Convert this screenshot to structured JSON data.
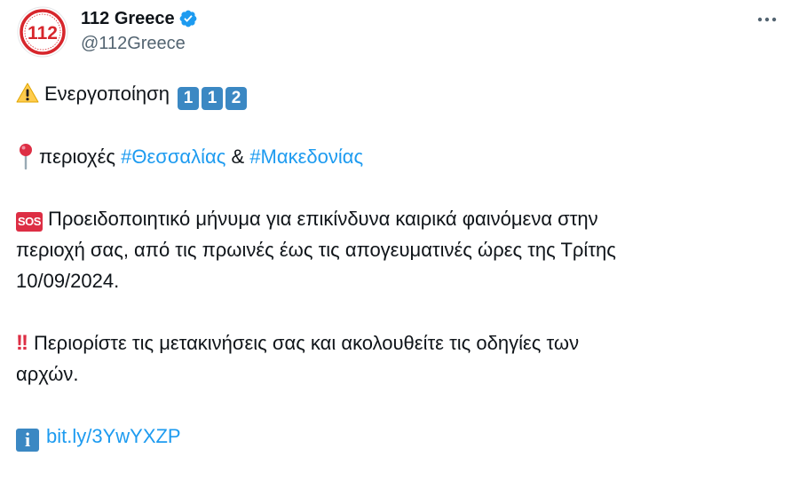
{
  "author": {
    "display_name": "112 Greece",
    "handle": "@112Greece",
    "avatar_text": "112",
    "verified": true
  },
  "icons": {
    "verified": "verified-badge-icon",
    "more": "more-options-icon",
    "warning": "warning-icon",
    "pin": "round-pushpin-icon",
    "sos": "sos-button-icon",
    "exclamation": "double-exclamation-icon",
    "info": "information-icon"
  },
  "colors": {
    "link": "#1d9bf0",
    "verified": "#1d9bf0",
    "keycap": "#3b88c3",
    "alert_red": "#dd2e44",
    "brand_red": "#d7262c",
    "secondary_text": "#536471"
  },
  "tweet": {
    "line1": {
      "text": "Ενεργοποίηση",
      "keycaps": [
        "1",
        "1",
        "2"
      ]
    },
    "line2": {
      "prefix": "περιοχές",
      "hashtag1": "#Θεσσαλίας",
      "amp": "&",
      "hashtag2": "#Μακεδονίας"
    },
    "line3": {
      "sos_label": "SOS",
      "text_a": "Προειδοποιητικό μήνυμα για επικίνδυνα καιρικά φαινόμενα στην",
      "text_b": "περιοχή σας, από τις πρωινές έως τις απογευματινές ώρες της Τρίτης",
      "text_c": "10/09/2024."
    },
    "line4": {
      "bangs": "!!",
      "text_a": "Περιορίστε τις μετακινήσεις σας και ακολουθείτε τις οδηγίες των",
      "text_b": "αρχών."
    },
    "line5": {
      "info_label": "i",
      "link": "bit.ly/3YwYXZP"
    }
  }
}
